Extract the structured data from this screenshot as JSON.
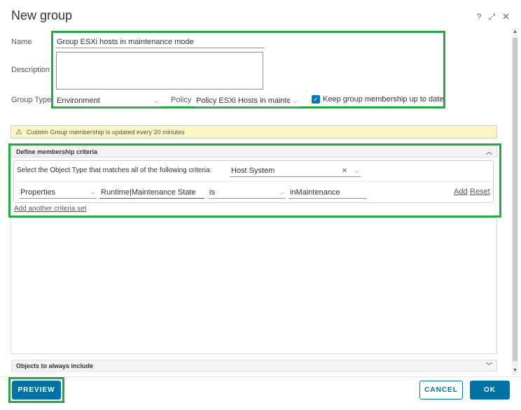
{
  "dialog": {
    "title": "New group",
    "help_glyph": "?",
    "expand_glyph": "⤢",
    "close_glyph": "✕"
  },
  "form": {
    "name_label": "Name",
    "name_value": "Group ESXi hosts in maintenance mode",
    "description_label": "Description",
    "description_value": "",
    "group_type_label": "Group Type",
    "group_type_value": "Environment",
    "policy_label": "Policy",
    "policy_value": "Policy ESXi Hosts in maintenance",
    "keep_membership_label": "Keep group membership up to date",
    "keep_membership_checked": true
  },
  "alert": {
    "text": "Custom Group membership is updated every 20 minutes"
  },
  "membership": {
    "section_title": "Define membership criteria",
    "object_type_prompt": "Select the Object Type that matches all of the following criteria:",
    "object_type_value": "Host System",
    "criteria": {
      "category": "Properties",
      "property": "Runtime|Maintenance State",
      "operator": "is",
      "value": "inMaintenance"
    },
    "add_label": "Add",
    "reset_label": "Reset",
    "add_criteria_set_label": "Add another criteria set"
  },
  "include_section": {
    "title": "Objects to always include"
  },
  "footer": {
    "preview_label": "PREVIEW",
    "cancel_label": "CANCEL",
    "ok_label": "OK"
  },
  "colors": {
    "highlight_green": "#29a744",
    "primary_blue": "#0072a3",
    "alert_yellow": "#fdf4c7"
  }
}
